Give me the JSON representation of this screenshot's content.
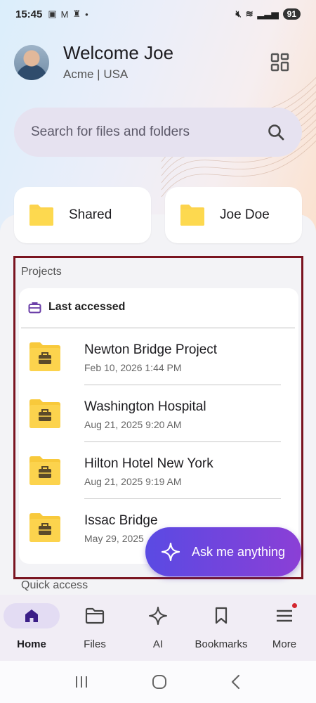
{
  "status_bar": {
    "time": "15:45",
    "battery": "91"
  },
  "header": {
    "welcome": "Welcome Joe",
    "org": "Acme | USA"
  },
  "search": {
    "placeholder": "Search for files and folders"
  },
  "quick_folders": [
    {
      "label": "Shared"
    },
    {
      "label": "Joe Doe"
    }
  ],
  "projects": {
    "title": "Projects",
    "section_label": "Last accessed",
    "items": [
      {
        "name": "Newton Bridge Project",
        "date": "Feb 10, 2026 1:44 PM"
      },
      {
        "name": "Washington Hospital",
        "date": "Aug 21, 2025 9:20 AM"
      },
      {
        "name": "Hilton Hotel New York",
        "date": "Aug 21, 2025 9:19 AM"
      },
      {
        "name": "Issac Bridge",
        "date": "May 29, 2025"
      }
    ]
  },
  "ask_button": {
    "label": "Ask me anything"
  },
  "quick_access": {
    "title": "Quick access"
  },
  "nav": [
    {
      "label": "Home",
      "icon": "home-icon",
      "active": true
    },
    {
      "label": "Files",
      "icon": "folder-icon"
    },
    {
      "label": "AI",
      "icon": "sparkle-icon"
    },
    {
      "label": "Bookmarks",
      "icon": "bookmark-icon"
    },
    {
      "label": "More",
      "icon": "menu-icon"
    }
  ],
  "colors": {
    "accent": "#3b1e87",
    "folder": "#fcd34d",
    "highlight_border": "#7a1420",
    "ask_gradient_start": "#5a4ae3",
    "ask_gradient_end": "#8b3fd6",
    "notification_dot": "#d3262f"
  }
}
